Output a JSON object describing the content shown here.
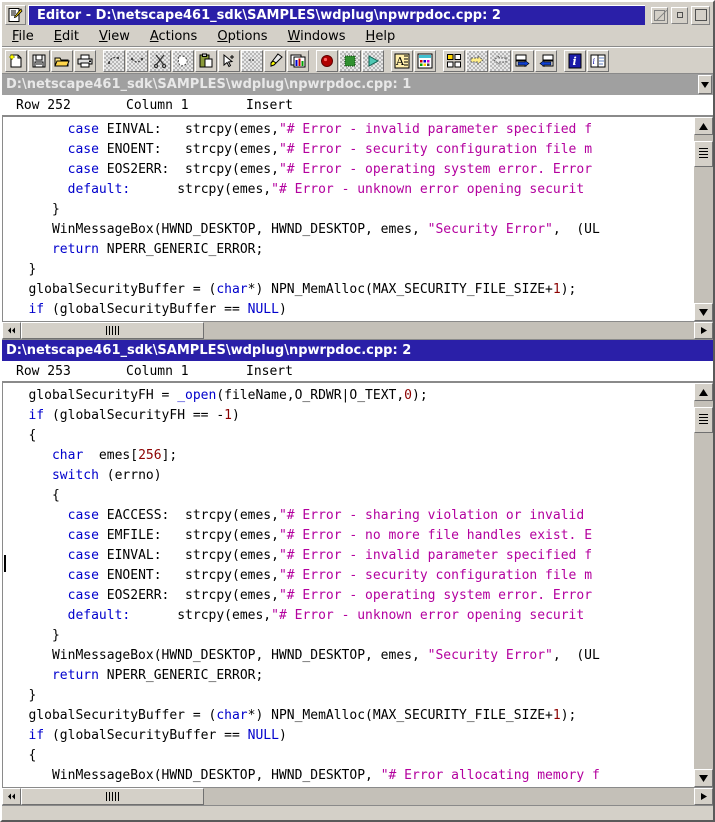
{
  "window": {
    "title": "Editor - D:\\netscape461_sdk\\SAMPLES\\wdplug\\npwrpdoc.cpp: 2",
    "sys_icon": "editor-document-pencil-icon",
    "buttons": {
      "hide": "Hide",
      "minimize": "Minimize",
      "maximize": "Maximize"
    }
  },
  "menu": {
    "items": [
      {
        "label": "File",
        "mnemonic": "F"
      },
      {
        "label": "Edit",
        "mnemonic": "E"
      },
      {
        "label": "View",
        "mnemonic": "V"
      },
      {
        "label": "Actions",
        "mnemonic": "A"
      },
      {
        "label": "Options",
        "mnemonic": "O"
      },
      {
        "label": "Windows",
        "mnemonic": "W"
      },
      {
        "label": "Help",
        "mnemonic": "H"
      }
    ]
  },
  "toolbar": {
    "groups": [
      {
        "buttons": [
          {
            "icon": "new-file-icon",
            "label": "New"
          },
          {
            "icon": "save-floppy-icon",
            "label": "Save"
          },
          {
            "icon": "open-folder-icon",
            "label": "Open"
          },
          {
            "icon": "print-icon",
            "label": "Print"
          }
        ]
      },
      {
        "buttons": [
          {
            "icon": "undo-dotted-icon",
            "label": "Undo"
          },
          {
            "icon": "redo-dotted-icon",
            "label": "Redo"
          },
          {
            "icon": "cut-scissors-icon",
            "label": "Cut"
          },
          {
            "icon": "copy-dotted-icon",
            "label": "Copy"
          },
          {
            "icon": "paste-clipboard-icon",
            "label": "Paste"
          },
          {
            "icon": "select-pointer-icon",
            "label": "Select"
          },
          {
            "icon": "clear-icon",
            "label": "Clear"
          },
          {
            "icon": "highlight-pen-icon",
            "label": "Highlight"
          },
          {
            "icon": "chart-window-icon",
            "label": "Chart"
          }
        ]
      },
      {
        "buttons": [
          {
            "icon": "record-button-icon",
            "label": "Record"
          },
          {
            "icon": "stop-icon",
            "label": "Stop"
          },
          {
            "icon": "play-icon",
            "label": "Play"
          }
        ]
      },
      {
        "buttons": [
          {
            "icon": "font-icon",
            "label": "Font"
          },
          {
            "icon": "color-palette-icon",
            "label": "Colors"
          }
        ]
      },
      {
        "buttons": [
          {
            "icon": "tile-windows-icon",
            "label": "Tile"
          },
          {
            "icon": "find-next-icon",
            "label": "Find Next"
          },
          {
            "icon": "find-previous-icon",
            "label": "Find Previous"
          },
          {
            "icon": "next-file-icon",
            "label": "Next File"
          },
          {
            "icon": "previous-file-icon",
            "label": "Previous File"
          }
        ]
      },
      {
        "buttons": [
          {
            "icon": "info-icon",
            "label": "Information"
          },
          {
            "icon": "help-book-icon",
            "label": "Help"
          }
        ]
      }
    ]
  },
  "panes": [
    {
      "active": false,
      "title": "D:\\netscape461_sdk\\SAMPLES\\wdplug\\npwrpdoc.cpp: 1",
      "status": {
        "row": "Row 252",
        "column": "Column 1",
        "mode": "Insert"
      },
      "lines": [
        [
          {
            "t": "        "
          },
          {
            "t": "case",
            "c": "kw"
          },
          {
            "t": " EINVAL:   "
          },
          {
            "t": "strcpy(emes,"
          },
          {
            "t": "\"# Error - invalid parameter specified f",
            "c": "str"
          }
        ],
        [
          {
            "t": "        "
          },
          {
            "t": "case",
            "c": "kw"
          },
          {
            "t": " ENOENT:   "
          },
          {
            "t": "strcpy(emes,"
          },
          {
            "t": "\"# Error - security configuration file m",
            "c": "str"
          }
        ],
        [
          {
            "t": "        "
          },
          {
            "t": "case",
            "c": "kw"
          },
          {
            "t": " EOS2ERR:  "
          },
          {
            "t": "strcpy(emes,"
          },
          {
            "t": "\"# Error - operating system error. Error",
            "c": "str"
          }
        ],
        [
          {
            "t": "        "
          },
          {
            "t": "default:",
            "c": "kw"
          },
          {
            "t": "      "
          },
          {
            "t": "strcpy(emes,"
          },
          {
            "t": "\"# Error - unknown error opening securit",
            "c": "str"
          }
        ],
        [
          {
            "t": "      }"
          }
        ],
        [
          {
            "t": "      WinMessageBox(HWND_DESKTOP, HWND_DESKTOP, emes, "
          },
          {
            "t": "\"Security Error\"",
            "c": "str"
          },
          {
            "t": ",  (UL"
          }
        ],
        [
          {
            "t": "      "
          },
          {
            "t": "return",
            "c": "kw"
          },
          {
            "t": " NPERR_GENERIC_ERROR;"
          }
        ],
        [
          {
            "t": "   }"
          }
        ],
        [
          {
            "t": "   globalSecurityBuffer = ("
          },
          {
            "t": "char",
            "c": "kw"
          },
          {
            "t": "*) NPN_MemAlloc(MAX_SECURITY_FILE_SIZE+"
          },
          {
            "t": "1",
            "c": "num"
          },
          {
            "t": ");"
          }
        ],
        [
          {
            "t": "   "
          },
          {
            "t": "if",
            "c": "kw"
          },
          {
            "t": " (globalSecurityBuffer == "
          },
          {
            "t": "NULL",
            "c": "kw"
          },
          {
            "t": ")"
          }
        ]
      ]
    },
    {
      "active": true,
      "title": "D:\\netscape461_sdk\\SAMPLES\\wdplug\\npwrpdoc.cpp: 2",
      "status": {
        "row": "Row 253",
        "column": "Column 1",
        "mode": "Insert"
      },
      "lines": [
        [
          {
            "t": "   globalSecurityFH = "
          },
          {
            "t": "_open",
            "c": "kw"
          },
          {
            "t": "(fileName,O_RDWR|O_TEXT,"
          },
          {
            "t": "0",
            "c": "num"
          },
          {
            "t": ");"
          }
        ],
        [
          {
            "t": "   "
          },
          {
            "t": "if",
            "c": "kw"
          },
          {
            "t": " (globalSecurityFH == -"
          },
          {
            "t": "1",
            "c": "num"
          },
          {
            "t": ")"
          }
        ],
        [
          {
            "t": "   {"
          }
        ],
        [
          {
            "t": "      "
          },
          {
            "t": "char",
            "c": "kw"
          },
          {
            "t": "  emes["
          },
          {
            "t": "256",
            "c": "num"
          },
          {
            "t": "];"
          }
        ],
        [
          {
            "t": "      "
          },
          {
            "t": "switch",
            "c": "kw"
          },
          {
            "t": " (errno)"
          }
        ],
        [
          {
            "t": "      {"
          }
        ],
        [
          {
            "t": "        "
          },
          {
            "t": "case",
            "c": "kw"
          },
          {
            "t": " EACCESS:  "
          },
          {
            "t": "strcpy(emes,"
          },
          {
            "t": "\"# Error - sharing violation or invalid",
            "c": "str"
          }
        ],
        [
          {
            "t": "        "
          },
          {
            "t": "case",
            "c": "kw"
          },
          {
            "t": " EMFILE:   "
          },
          {
            "t": "strcpy(emes,"
          },
          {
            "t": "\"# Error - no more file handles exist. E",
            "c": "str"
          }
        ],
        [
          {
            "t": "        "
          },
          {
            "t": "case",
            "c": "kw"
          },
          {
            "t": " EINVAL:   "
          },
          {
            "t": "strcpy(emes,"
          },
          {
            "t": "\"# Error - invalid parameter specified f",
            "c": "str"
          }
        ],
        [
          {
            "t": "        "
          },
          {
            "t": "case",
            "c": "kw"
          },
          {
            "t": " ENOENT:   "
          },
          {
            "t": "strcpy(emes,"
          },
          {
            "t": "\"# Error - security configuration file m",
            "c": "str"
          }
        ],
        [
          {
            "t": "        "
          },
          {
            "t": "case",
            "c": "kw"
          },
          {
            "t": " EOS2ERR:  "
          },
          {
            "t": "strcpy(emes,"
          },
          {
            "t": "\"# Error - operating system error. Error",
            "c": "str"
          }
        ],
        [
          {
            "t": "        "
          },
          {
            "t": "default:",
            "c": "kw"
          },
          {
            "t": "      "
          },
          {
            "t": "strcpy(emes,"
          },
          {
            "t": "\"# Error - unknown error opening securit",
            "c": "str"
          }
        ],
        [
          {
            "t": "      }"
          }
        ],
        [
          {
            "t": "      WinMessageBox(HWND_DESKTOP, HWND_DESKTOP, emes, "
          },
          {
            "t": "\"Security Error\"",
            "c": "str"
          },
          {
            "t": ",  (UL"
          }
        ],
        [
          {
            "t": "      "
          },
          {
            "t": "return",
            "c": "kw"
          },
          {
            "t": " NPERR_GENERIC_ERROR;"
          }
        ],
        [
          {
            "t": "   }"
          }
        ],
        [
          {
            "t": "   globalSecurityBuffer = ("
          },
          {
            "t": "char",
            "c": "kw"
          },
          {
            "t": "*) NPN_MemAlloc(MAX_SECURITY_FILE_SIZE+"
          },
          {
            "t": "1",
            "c": "num"
          },
          {
            "t": ");"
          }
        ],
        [
          {
            "t": "   "
          },
          {
            "t": "if",
            "c": "kw"
          },
          {
            "t": " (globalSecurityBuffer == "
          },
          {
            "t": "NULL",
            "c": "kw"
          },
          {
            "t": ")"
          }
        ],
        [
          {
            "t": "   {"
          }
        ],
        [
          {
            "t": "      WinMessageBox(HWND_DESKTOP, HWND_DESKTOP, "
          },
          {
            "t": "\"# Error allocating memory f",
            "c": "str"
          }
        ]
      ]
    }
  ],
  "colors": {
    "titlebar_active": "#2a1fa8",
    "titlebar_inactive": "#a0a0a0",
    "face": "#d4d0c8",
    "keyword": "#0000cc",
    "string": "#b3009e",
    "number": "#8b0000",
    "code_bg": "#ffffff"
  }
}
